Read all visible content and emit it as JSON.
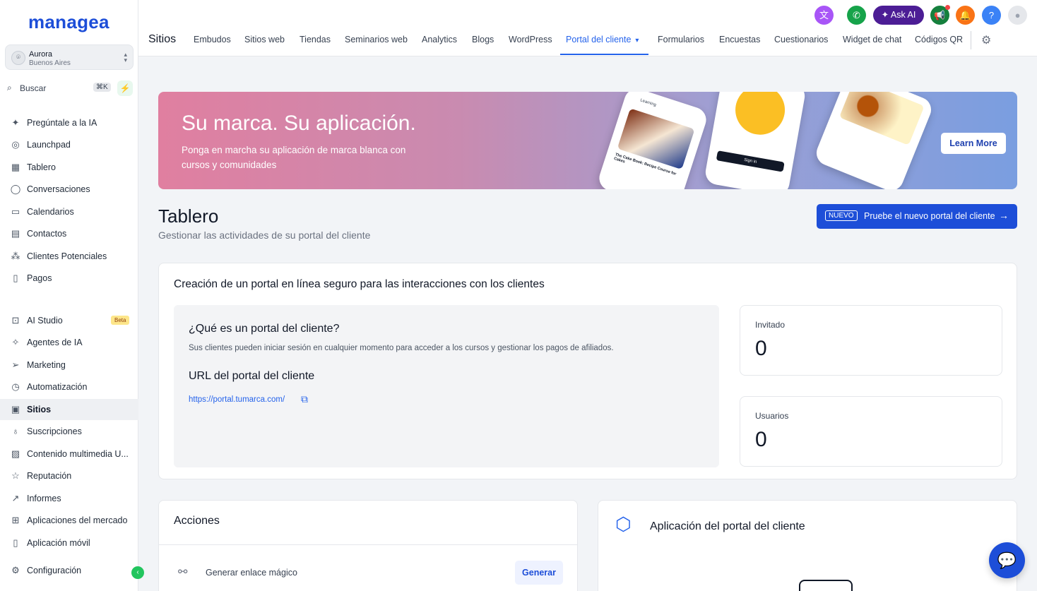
{
  "brand": {
    "logo": "managea"
  },
  "account": {
    "name": "Aurora",
    "location": "Buenos Aires"
  },
  "search": {
    "label": "Buscar",
    "shortcut": "⌘K"
  },
  "sidebar": {
    "items": [
      {
        "label": "Pregúntale a la IA",
        "icon": "sparkles-icon"
      },
      {
        "label": "Launchpad",
        "icon": "rocket-icon"
      },
      {
        "label": "Tablero",
        "icon": "grid-icon"
      },
      {
        "label": "Conversaciones",
        "icon": "chat-bubble-icon"
      },
      {
        "label": "Calendarios",
        "icon": "calendar-icon"
      },
      {
        "label": "Contactos",
        "icon": "contacts-icon"
      },
      {
        "label": "Clientes Potenciales",
        "icon": "leads-icon"
      },
      {
        "label": "Pagos",
        "icon": "receipt-icon"
      },
      {
        "label": "AI Studio",
        "icon": "ai-studio-icon",
        "badge": "Beta"
      },
      {
        "label": "Agentes de IA",
        "icon": "agent-icon"
      },
      {
        "label": "Marketing",
        "icon": "send-icon"
      },
      {
        "label": "Automatización",
        "icon": "automation-icon"
      },
      {
        "label": "Sitios",
        "icon": "sites-icon",
        "active": true
      },
      {
        "label": "Suscripciones",
        "icon": "award-icon"
      },
      {
        "label": "Contenido multimedia U...",
        "icon": "image-icon"
      },
      {
        "label": "Reputación",
        "icon": "star-icon"
      },
      {
        "label": "Informes",
        "icon": "trend-icon"
      },
      {
        "label": "Aplicaciones del mercado",
        "icon": "apps-icon"
      },
      {
        "label": "Aplicación móvil",
        "icon": "mobile-icon"
      },
      {
        "label": "Configuración",
        "icon": "gear-icon"
      }
    ]
  },
  "header": {
    "section": "Sitios",
    "ask_ai": "Ask AI",
    "tabs": [
      "Embudos",
      "Sitios web",
      "Tiendas",
      "Seminarios web",
      "Analytics",
      "Blogs",
      "WordPress",
      "Portal del cliente",
      "Formularios",
      "Encuestas",
      "Cuestionarios",
      "Widget de chat",
      "Códigos QR"
    ],
    "active_tab": "Portal del cliente",
    "help": "?"
  },
  "banner": {
    "title": "Su marca. Su aplicación.",
    "subtitle": "Ponga en marcha su aplicación de marca blanca con cursos y comunidades",
    "cta": "Learn More",
    "mock_phone_texts": [
      "Learning",
      "The Cake Book: Recipe Course for Cakes",
      "Sign in"
    ]
  },
  "page": {
    "title": "Tablero",
    "subtitle": "Gestionar las actividades de su portal del cliente",
    "new_tag": "NUEVO",
    "new_label": "Pruebe el nuevo portal del cliente"
  },
  "portal_card": {
    "title": "Creación de un portal en línea seguro para las interacciones con los clientes",
    "question": "¿Qué es un portal del cliente?",
    "description": "Sus clientes pueden iniciar sesión en cualquier momento para acceder a los cursos y gestionar los pagos de afiliados.",
    "url_heading": "URL del portal del cliente",
    "url": "https://portal.tumarca.com/"
  },
  "stats": [
    {
      "label": "Invitado",
      "value": "0"
    },
    {
      "label": "Usuarios",
      "value": "0"
    }
  ],
  "actions": {
    "title": "Acciones",
    "item_label": "Generar enlace mágico",
    "item_button": "Generar"
  },
  "app_card": {
    "title": "Aplicación del portal del cliente"
  },
  "colors": {
    "accent": "#1d4ed8",
    "active_tab": "#2563eb",
    "success": "#22c55e",
    "askai": "#4c1d95"
  }
}
